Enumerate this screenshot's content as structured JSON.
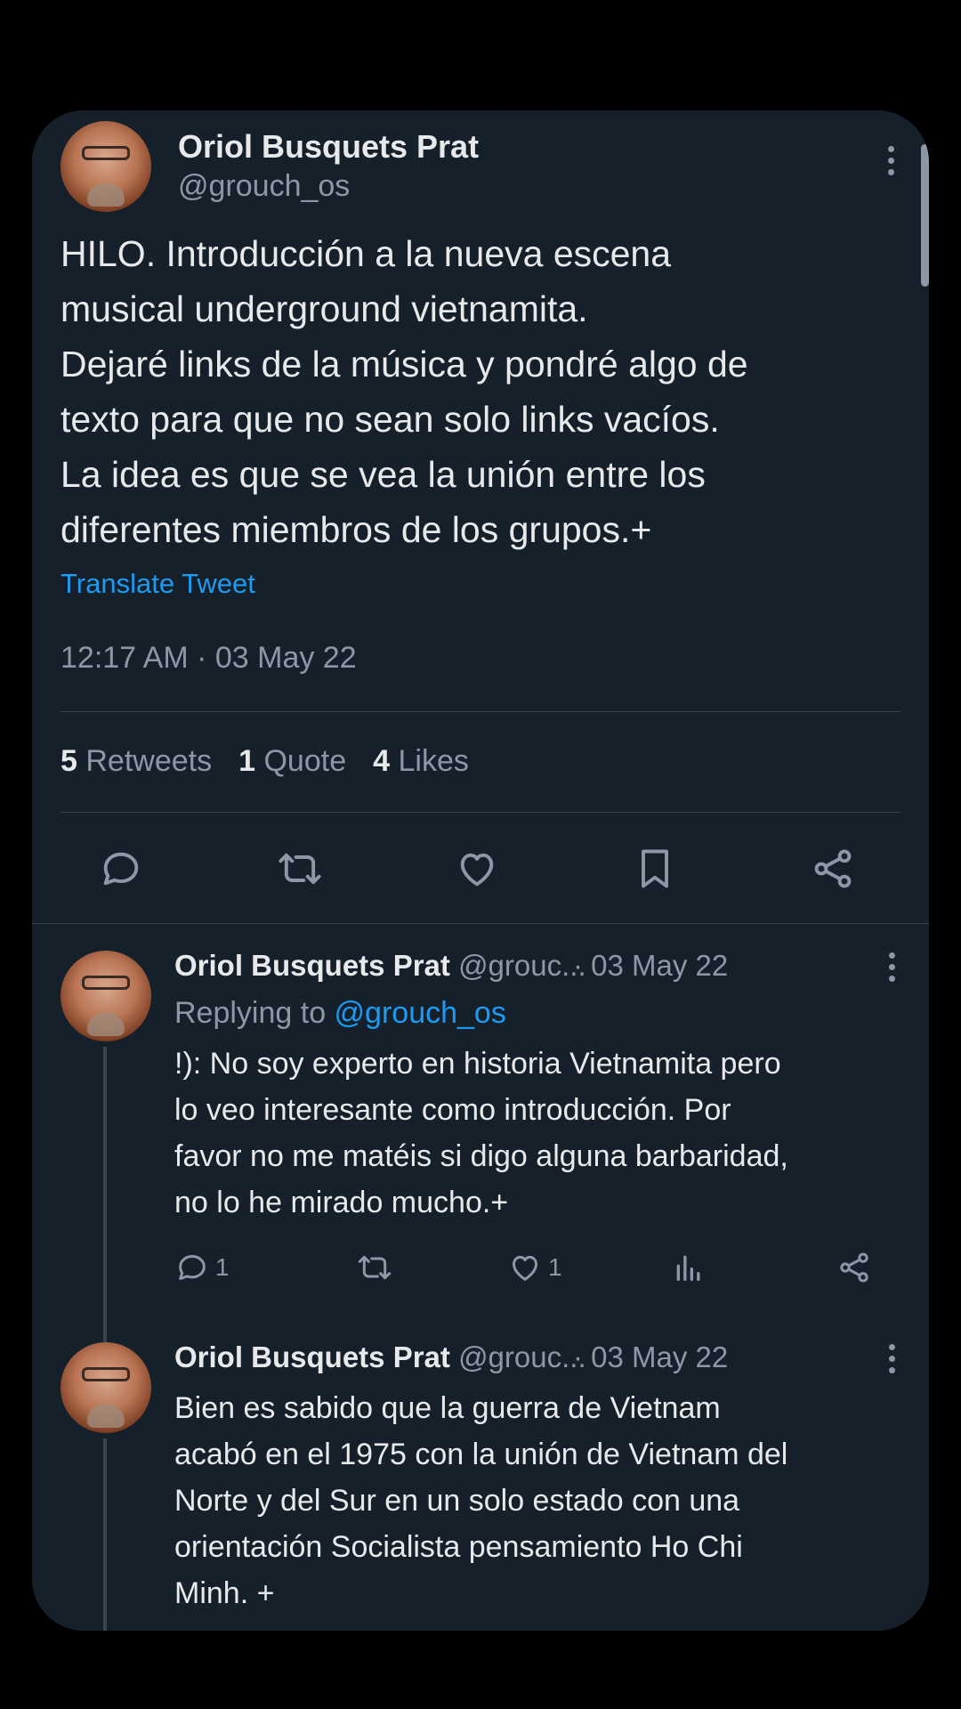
{
  "main_tweet": {
    "name": "Oriol Busquets Prat",
    "handle": "@grouch_os",
    "text": "HILO. Introducción a la nueva escena\nmusical underground vietnamita.\nDejaré links de la música y pondré algo de\ntexto para que no sean solo links vacíos.\nLa idea es que se vea la unión entre los\ndiferentes miembros de los grupos.+",
    "translate_label": "Translate Tweet",
    "timestamp": "12:17 AM · 03 May 22",
    "stats": [
      {
        "count": "5",
        "label": "Retweets"
      },
      {
        "count": "1",
        "label": "Quote"
      },
      {
        "count": "4",
        "label": "Likes"
      }
    ],
    "actions": [
      "reply-icon",
      "retweet-icon",
      "like-icon",
      "bookmark-icon",
      "share-icon"
    ]
  },
  "replies": [
    {
      "name": "Oriol Busquets Prat",
      "handle": "@grouc...",
      "date": "· 03 May 22",
      "replying_prefix": "Replying to ",
      "replying_to": "@grouch_os",
      "text": "!): No soy experto en historia Vietnamita pero\nlo veo interesante como introducción. Por\nfavor no me matéis si digo alguna barbaridad,\nno lo he mirado mucho.+",
      "reply_count": "1",
      "like_count": "1"
    },
    {
      "name": "Oriol Busquets Prat",
      "handle": "@grouc...",
      "date": "· 03 May 22",
      "text": "Bien es sabido que la guerra de Vietnam\nacabó en el 1975 con la unión de Vietnam del\nNorte y del Sur en un solo estado con una\norientación Socialista pensamiento Ho Chi\nMinh. +"
    }
  ],
  "colors": {
    "background": "#15202b",
    "text_primary": "#e7e9ea",
    "text_secondary": "#8b98a5",
    "link": "#1d9bf0",
    "divider": "#38444d"
  }
}
